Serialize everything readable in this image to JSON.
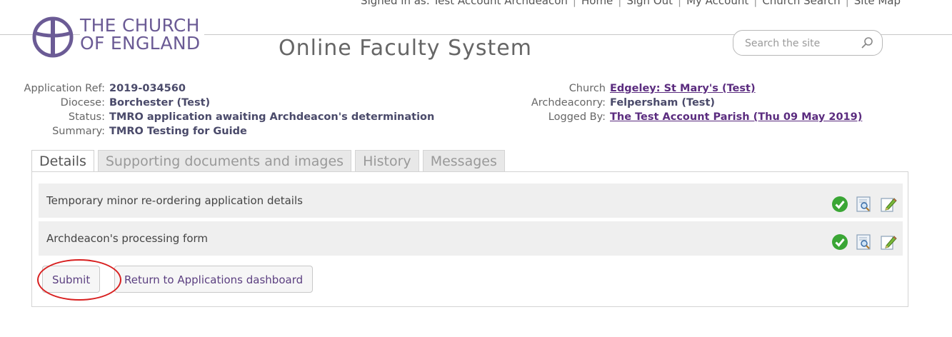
{
  "topnav": {
    "signed_in": "Signed in as: Test Account Archdeacon",
    "links": [
      "Home",
      "Sign Out",
      "My Account",
      "Church Search",
      "Site Map"
    ]
  },
  "logo": {
    "line1": "THE CHURCH",
    "line2": "OF ENGLAND",
    "icon": "church-of-england-logo-icon",
    "color": "#6b5b95"
  },
  "system_title": "Online Faculty System",
  "search": {
    "placeholder": "Search the site",
    "icon": "magnifier-icon"
  },
  "application": {
    "left": [
      {
        "label": "Application Ref:",
        "value": "2019-034560"
      },
      {
        "label": "Diocese:",
        "value": "Borchester (Test)"
      },
      {
        "label": "Status:",
        "value": "TMRO application awaiting Archdeacon's determination"
      },
      {
        "label": "Summary:",
        "value": "TMRO Testing for Guide"
      }
    ],
    "right": [
      {
        "label": "Church",
        "value": "Edgeley: St Mary's (Test)"
      },
      {
        "label": "Archdeaconry:",
        "value": "Felpersham (Test)"
      },
      {
        "label": "Logged By:",
        "value": "The Test Account Parish (Thu 09 May 2019)"
      }
    ]
  },
  "tabs": [
    "Details",
    "Supporting documents and images",
    "History",
    "Messages"
  ],
  "active_tab": "Details",
  "items": [
    {
      "label": "Temporary minor re-ordering application details",
      "icons": [
        "complete-check-icon",
        "view-icon",
        "edit-icon"
      ]
    },
    {
      "label": "Archdeacon's processing form",
      "icons": [
        "complete-check-icon",
        "view-icon",
        "edit-icon"
      ]
    }
  ],
  "buttons": {
    "submit": "Submit",
    "return": "Return to Applications dashboard"
  },
  "colors": {
    "accent": "#5b2c7f",
    "highlight_circle": "#d82020",
    "check": "#3aa635"
  }
}
